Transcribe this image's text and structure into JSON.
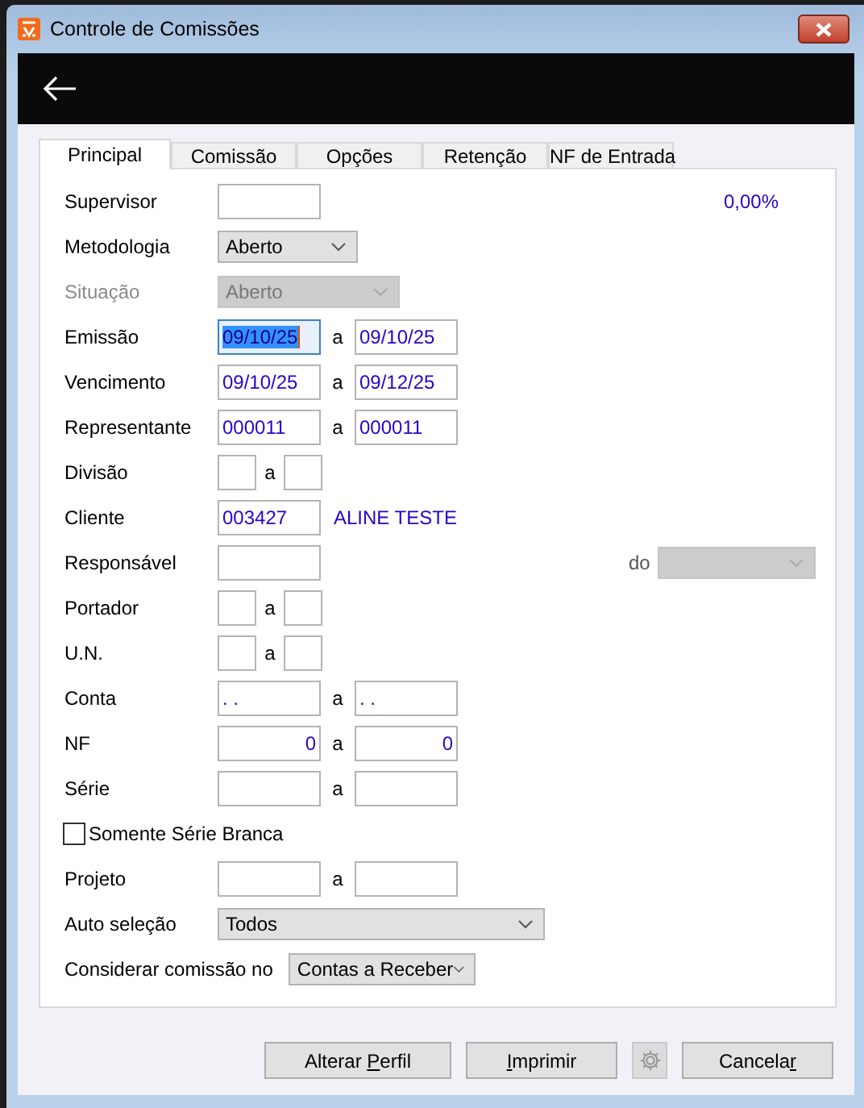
{
  "window": {
    "title": "Controle de Comissões"
  },
  "tabs": [
    {
      "label": "Principal",
      "selected": true
    },
    {
      "label": "Comissão",
      "selected": false
    },
    {
      "label": "Opções",
      "selected": false
    },
    {
      "label": "Retenção",
      "selected": false
    },
    {
      "label": "NF de Entrada",
      "selected": false
    }
  ],
  "rows": [
    {
      "kind": "field",
      "label": "Supervisor",
      "disabled": false,
      "fields": [
        {
          "focused": false
        }
      ],
      "aside": "0,00%"
    },
    {
      "kind": "select",
      "label": "Metodologia",
      "disabled": false,
      "value": "Aberto"
    },
    {
      "kind": "select",
      "label": "Situação",
      "disabled": true,
      "value": "Aberto"
    },
    {
      "kind": "range",
      "label": "Emissão",
      "disabled": false,
      "separator": "a",
      "fields": [
        {
          "value": "09/10/25",
          "focused": true
        },
        {
          "value": "09/10/25",
          "focused": false
        }
      ]
    },
    {
      "kind": "range",
      "label": "Vencimento",
      "disabled": false,
      "separator": "a",
      "fields": [
        {
          "value": "09/10/25",
          "focused": false
        },
        {
          "value": "09/12/25",
          "focused": false
        }
      ]
    },
    {
      "kind": "range",
      "label": "Representante",
      "disabled": false,
      "separator": "a",
      "fields": [
        {
          "value": "000011",
          "focused": false
        },
        {
          "value": "000011",
          "focused": false
        }
      ]
    },
    {
      "kind": "short_range",
      "label": "Divisão",
      "disabled": false,
      "separator": "a",
      "fields": [
        {
          "focused": false
        },
        {
          "focused": false
        }
      ]
    },
    {
      "kind": "client",
      "label": "Cliente",
      "disabled": false,
      "fields": [
        {
          "value": "003427",
          "focused": false
        }
      ],
      "name": "ALINE TESTE"
    },
    {
      "kind": "owner",
      "label": "Responsável",
      "disabled": false,
      "fields": [
        {
          "focused": false
        }
      ],
      "do_label": "do",
      "do_disabled": true
    },
    {
      "kind": "short_range",
      "label": "Portador",
      "disabled": false,
      "separator": "a",
      "fields": [
        {
          "focused": false
        },
        {
          "focused": false
        }
      ]
    },
    {
      "kind": "short_range",
      "label": "U.N.",
      "disabled": false,
      "separator": "a",
      "fields": [
        {
          "focused": false
        },
        {
          "focused": false
        }
      ]
    },
    {
      "kind": "range",
      "label": "Conta",
      "disabled": false,
      "separator": "a",
      "fields": [
        {
          "value": ". .",
          "focused": false
        },
        {
          "value": ". .",
          "focused": false
        }
      ]
    },
    {
      "kind": "number_range",
      "label": "NF",
      "disabled": false,
      "separator": "a",
      "fields": [
        {
          "value": "0",
          "focused": false
        },
        {
          "value": "0",
          "focused": false
        }
      ]
    },
    {
      "kind": "range",
      "label": "Série",
      "disabled": false,
      "separator": "a",
      "fields": [
        {
          "focused": false
        },
        {
          "focused": false
        }
      ]
    },
    {
      "kind": "checkbox",
      "label": "Somente Série Branca",
      "checked": false
    },
    {
      "kind": "range",
      "label": "Projeto",
      "disabled": false,
      "separator": "a",
      "fields": [
        {
          "focused": false
        },
        {
          "focused": false
        }
      ]
    },
    {
      "kind": "wide_select",
      "label": "Auto seleção",
      "disabled": false,
      "value": "Todos"
    },
    {
      "kind": "select",
      "label": "Considerar comissão no",
      "disabled": false,
      "value": "Contas a Receber"
    }
  ],
  "buttons": [
    {
      "kind": "text",
      "before": "Alterar ",
      "key": "P",
      "after": "erfil"
    },
    {
      "kind": "text",
      "key": "I",
      "after": "mprimir"
    },
    {
      "kind": "gear"
    },
    {
      "kind": "text",
      "before": "Cancela",
      "key": "r"
    }
  ]
}
